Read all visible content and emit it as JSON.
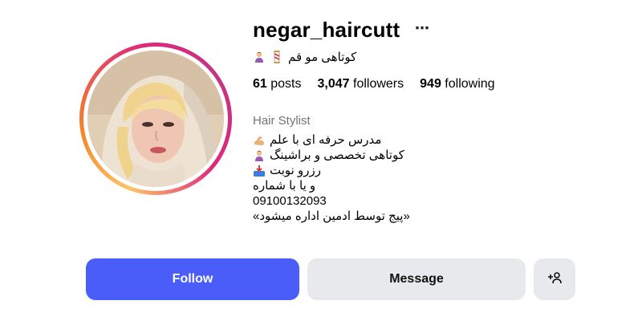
{
  "profile": {
    "username": "negar_haircutt",
    "more_icon": "⋯",
    "full_name": "کوتاهی مو قم",
    "full_name_icons": [
      "woman-getting-haircut-icon",
      "scissors-pole-icon"
    ],
    "stats": {
      "posts_count": "61",
      "posts_label": "posts",
      "followers_count": "3,047",
      "followers_label": "followers",
      "following_count": "949",
      "following_label": "following"
    },
    "category": "Hair Stylist",
    "bio": {
      "line1": "مدرس حرفه ای با علم",
      "line2": "کوتاهی تخصصی و براشینگ",
      "line3": "رزرو نوبت",
      "line4": "و یا با شماره",
      "line5": "09100132093",
      "line6": "«پیج توسط ادمین اداره میشود»"
    }
  },
  "actions": {
    "follow_label": "Follow",
    "message_label": "Message",
    "add_user_icon": "+👤"
  },
  "colors": {
    "follow_button": "#4a5df9",
    "secondary_button": "#e8e9ec",
    "category_text": "#737373",
    "ring_gradient": [
      "#fdc468",
      "#f58529",
      "#dd2a7b",
      "#c13584"
    ]
  }
}
